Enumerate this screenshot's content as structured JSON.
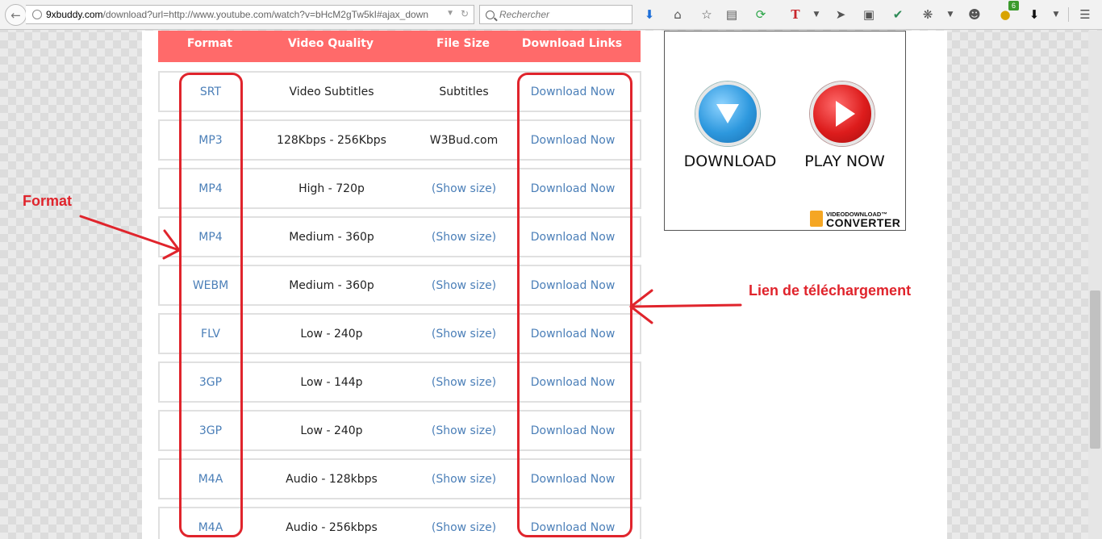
{
  "browser": {
    "url_host": "9xbuddy.com",
    "url_rest": "/download?url=http://www.youtube.com/watch?v=bHcM2gTw5kI#ajax_down",
    "search_placeholder": "Rechercher",
    "notification_count": "6"
  },
  "table": {
    "headers": [
      "Format",
      "Video Quality",
      "File Size",
      "Download Links"
    ],
    "rows": [
      {
        "format": "SRT",
        "quality": "Video Subtitles",
        "size": "Subtitles",
        "link": "Download Now"
      },
      {
        "format": "MP3",
        "quality": "128Kbps - 256Kbps",
        "size": "W3Bud.com",
        "link": "Download Now"
      },
      {
        "format": "MP4",
        "quality": "High - 720p",
        "size": "(Show size)",
        "link": "Download Now"
      },
      {
        "format": "MP4",
        "quality": "Medium - 360p",
        "size": "(Show size)",
        "link": "Download Now"
      },
      {
        "format": "WEBM",
        "quality": "Medium - 360p",
        "size": "(Show size)",
        "link": "Download Now"
      },
      {
        "format": "FLV",
        "quality": "Low - 240p",
        "size": "(Show size)",
        "link": "Download Now"
      },
      {
        "format": "3GP",
        "quality": "Low - 144p",
        "size": "(Show size)",
        "link": "Download Now"
      },
      {
        "format": "3GP",
        "quality": "Low - 240p",
        "size": "(Show size)",
        "link": "Download Now"
      },
      {
        "format": "M4A",
        "quality": "Audio - 128kbps",
        "size": "(Show size)",
        "link": "Download Now"
      },
      {
        "format": "M4A",
        "quality": "Audio - 256kbps",
        "size": "(Show size)",
        "link": "Download Now"
      }
    ]
  },
  "annotations": {
    "format_label": "Format",
    "link_label": "Lien de téléchargement"
  },
  "ad": {
    "download_label": "DOWNLOAD",
    "play_label": "PLAY NOW",
    "logo_top": "VIDEODOWNLOAD™",
    "logo_bottom": "CONVERTER"
  },
  "colors": {
    "header_bg": "#ff6a6a",
    "link": "#4b7fb8",
    "annotation": "#e0242c"
  }
}
